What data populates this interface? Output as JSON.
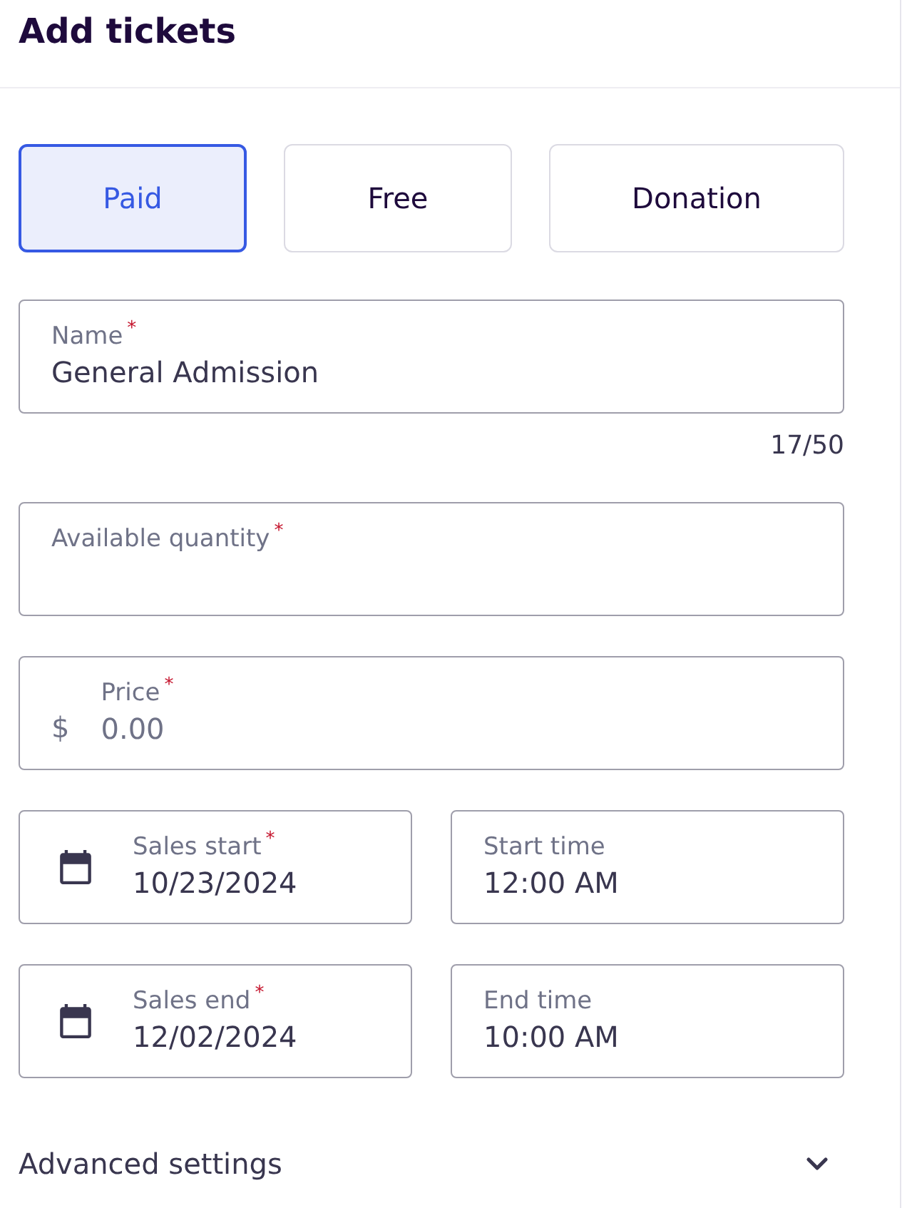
{
  "header": {
    "title": "Add tickets"
  },
  "ticket_types": [
    {
      "label": "Paid",
      "selected": true
    },
    {
      "label": "Free",
      "selected": false
    },
    {
      "label": "Donation",
      "selected": false
    }
  ],
  "form_rows": [
    {
      "fields": [
        {
          "kind": "text",
          "label": "Name$^{*}$",
          "value": "General Admission",
          "counter": "17/50"
        }
      ]
    },
    {
      "fields": [
        {
          "kind": "text",
          "label": "Available quantity$^{*}$"
        }
      ]
    },
    {
      "fields": [
        {
          "kind": "currency",
          "label": "Price$^{*}$",
          "prefix": "$",
          "placeholder": "0.00"
        }
      ]
    },
    {
      "fields": [
        {
          "kind": "date",
          "label": "Sales start$^{*}$",
          "value": "10/23/2024"
        },
        {
          "kind": "time",
          "label": "Start time",
          "value": "12:00 AM"
        }
      ]
    },
    {
      "fields": [
        {
          "kind": "date",
          "label": "Sales end$^{*}$",
          "value": "12/02/2024"
        },
        {
          "kind": "time",
          "label": "End time",
          "value": "10:00 AM"
        }
      ]
    }
  ],
  "advanced_settings": {
    "label": "Advanced settings",
    "expanded": false
  }
}
